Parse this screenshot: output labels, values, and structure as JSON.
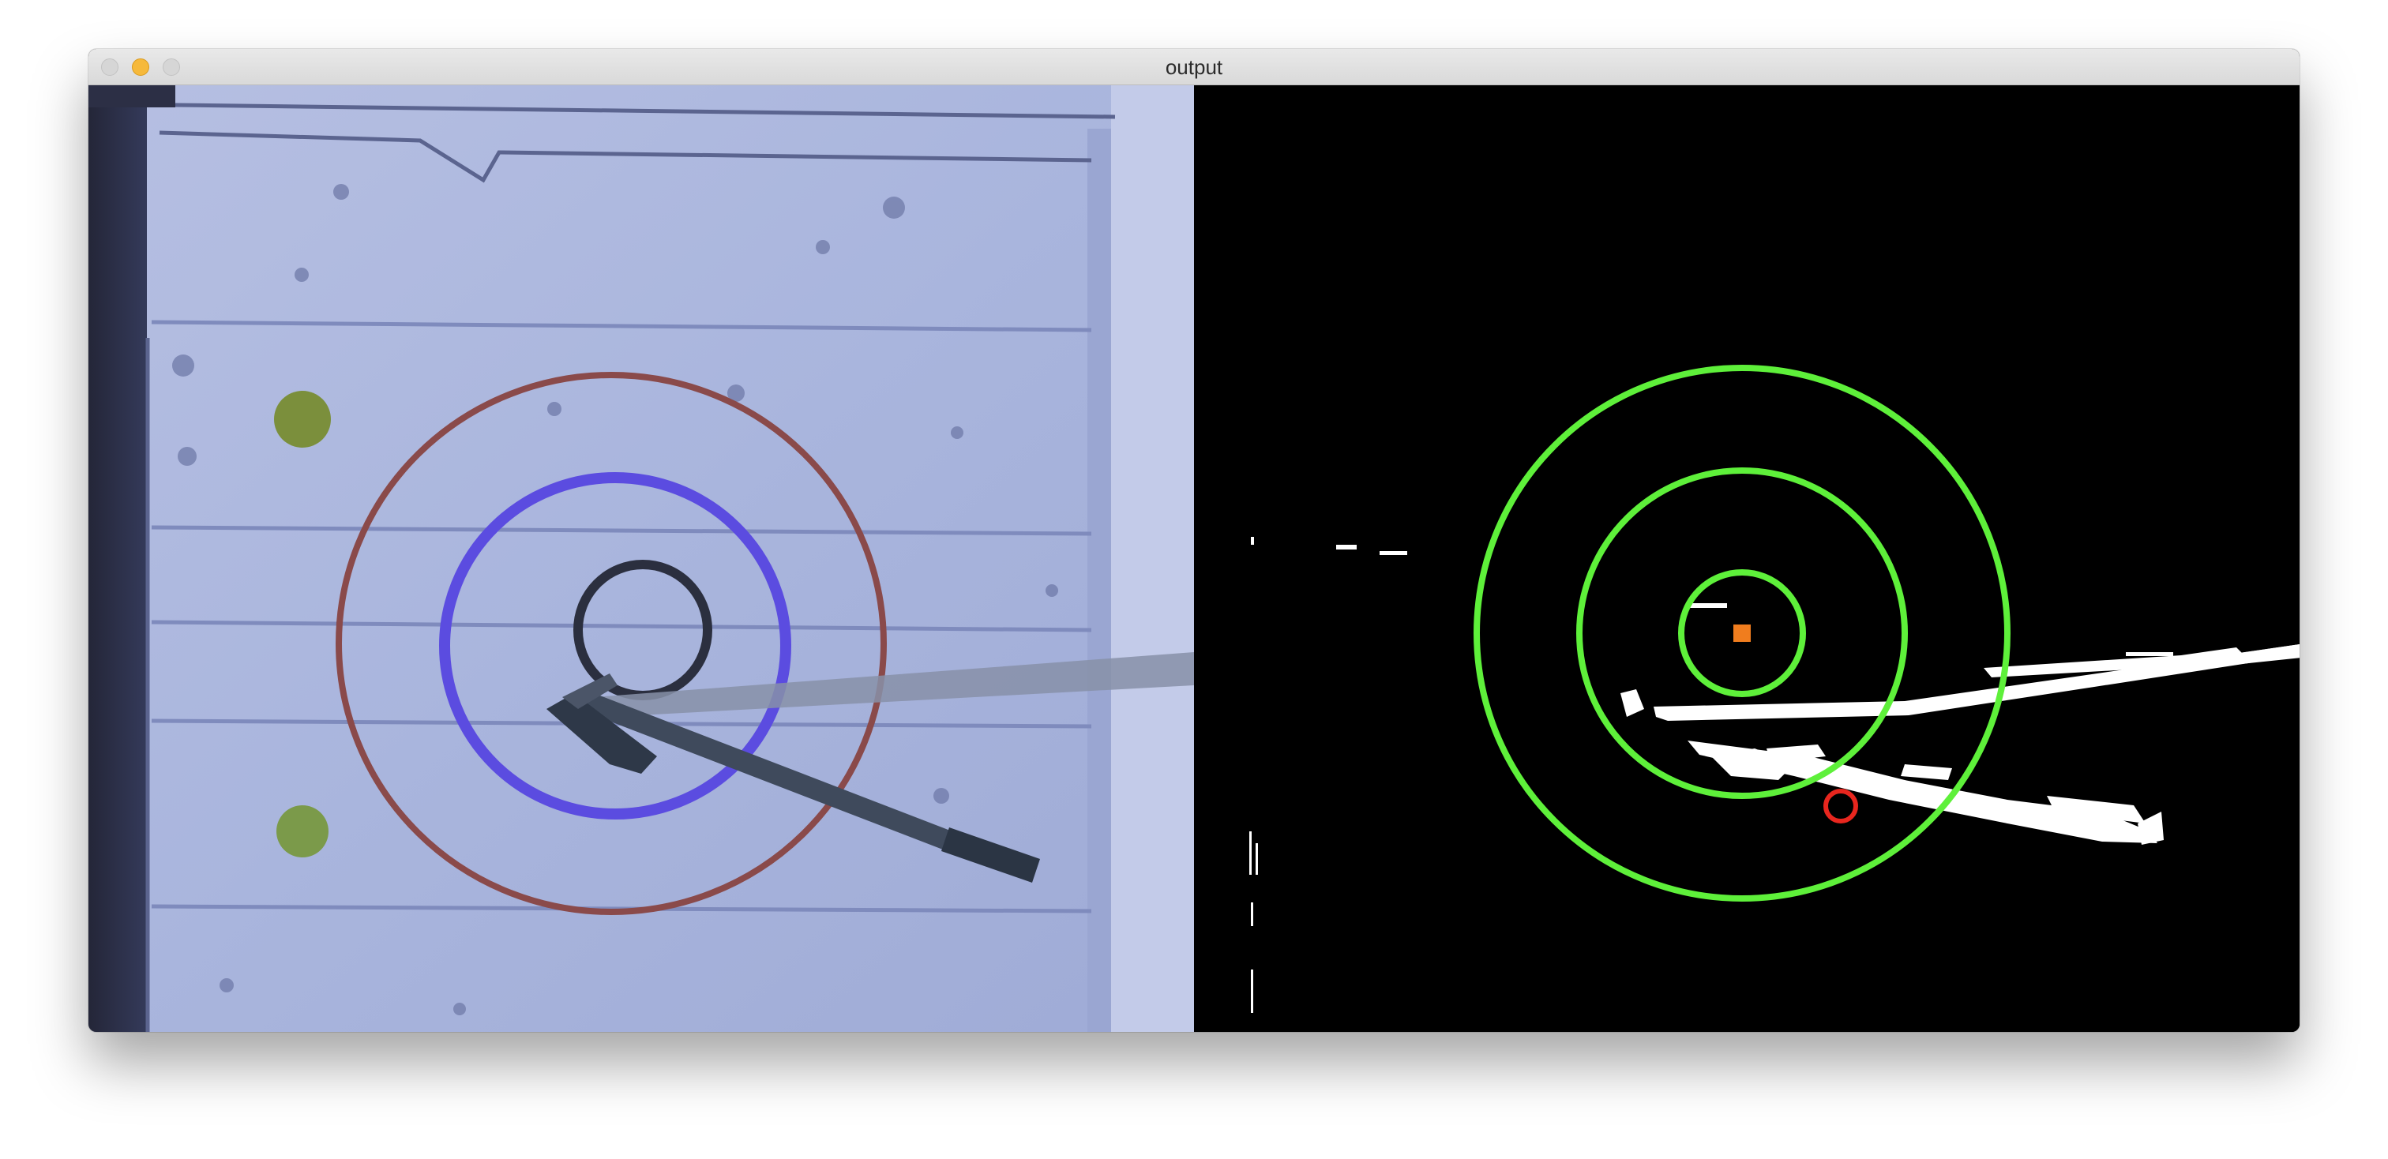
{
  "window": {
    "title": "output"
  },
  "colors": {
    "detected_rings": "#5ef03a",
    "target_center": "#f07d1e",
    "impact_marker": "#e8261e",
    "mask_foreground": "#ffffff",
    "mask_background": "#000000",
    "board": "#aab6de"
  },
  "panes": {
    "left": "camera-frame",
    "right": "threshold-mask-with-detected-rings"
  }
}
